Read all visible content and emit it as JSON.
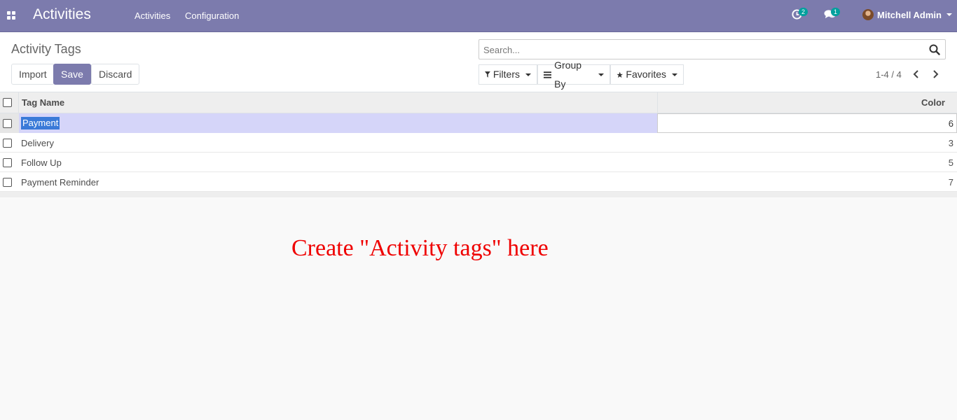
{
  "navbar": {
    "app_title": "Activities",
    "menu": [
      "Activities",
      "Configuration"
    ],
    "activity_badge": "2",
    "message_badge": "1",
    "user_name": "Mitchell Admin"
  },
  "control_panel": {
    "breadcrumb": "Activity Tags",
    "buttons": {
      "import": "Import",
      "save": "Save",
      "discard": "Discard"
    },
    "search_placeholder": "Search...",
    "filters_label": "Filters",
    "group_by_label": "Group By",
    "favorites_label": "Favorites",
    "pager": "1-4 / 4"
  },
  "list": {
    "columns": {
      "tag_name": "Tag Name",
      "color": "Color"
    },
    "rows": [
      {
        "name": "Payment",
        "color": "6"
      },
      {
        "name": "Delivery",
        "color": "3"
      },
      {
        "name": "Follow Up",
        "color": "5"
      },
      {
        "name": "Payment Reminder",
        "color": "7"
      }
    ]
  },
  "annotation": "Create \"Activity tags\" here",
  "colors": {
    "brand": "#7c7bad",
    "badge": "#00a09d",
    "annotation": "#ef0000",
    "row_edit": "#d5d5f9"
  }
}
